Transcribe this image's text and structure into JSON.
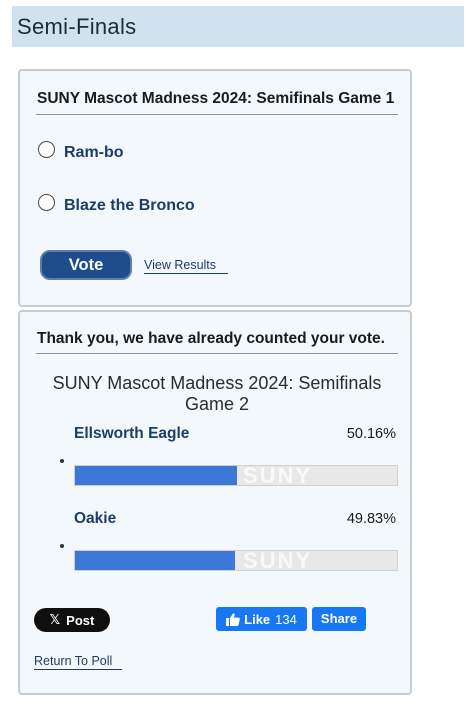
{
  "page": {
    "section_title": "Semi-Finals"
  },
  "poll1": {
    "title": "SUNY Mascot Madness 2024: Semifinals Game 1",
    "options": [
      {
        "label": "Ram-bo",
        "selected": false
      },
      {
        "label": "Blaze the Bronco",
        "selected": false
      }
    ],
    "vote_label": "Vote",
    "view_results_label": "View Results"
  },
  "poll2": {
    "notice": "Thank you, we have already counted your vote.",
    "title": "SUNY Mascot Madness 2024: Semifinals Game 2",
    "results": [
      {
        "name": "Ellsworth Eagle",
        "percent_text": "50.16%",
        "percent": 50.16
      },
      {
        "name": "Oakie",
        "percent_text": "49.83%",
        "percent": 49.83
      }
    ],
    "watermark": "SUNY",
    "share": {
      "x_icon": "x-logo-icon",
      "x_post_label": "Post",
      "fb_like_label": "Like",
      "fb_like_count": "134",
      "fb_share_label": "Share"
    },
    "return_label": "Return To Poll"
  },
  "colors": {
    "header_bg": "#d0e2ee",
    "card_bg": "#f3f8fc",
    "link": "#1c3d69",
    "vote_button": "#1f4d8c",
    "bar_fill": "#3d78d8",
    "facebook": "#1877f2"
  }
}
